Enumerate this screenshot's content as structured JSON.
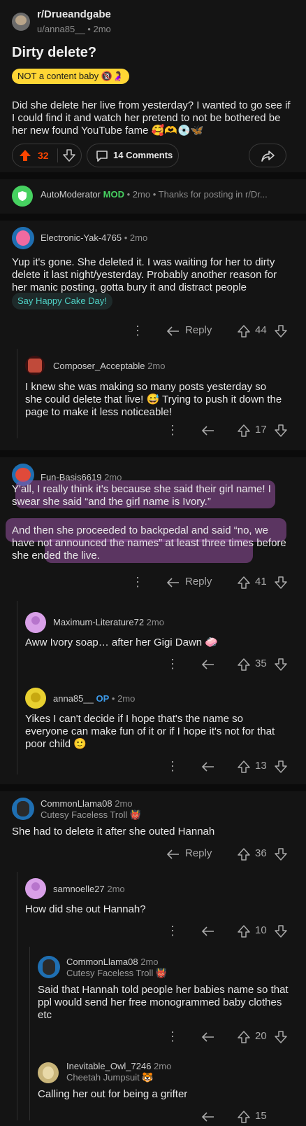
{
  "post": {
    "subreddit": "r/Drueandgabe",
    "author": "u/anna85__",
    "age": "2mo",
    "title": "Dirty delete?",
    "flair": "NOT a content baby",
    "body": "Did she delete her live from yesterday? I wanted to go see if I could find it and watch her pretend to not be bothered be her new found YouTube fame 🥰🫶💿🦋",
    "votes": "32",
    "comments_label": "14 Comments"
  },
  "automod": {
    "name": "AutoModerator",
    "mod_badge": "MOD",
    "age": "2mo",
    "preview": "Thanks for posting in r/Dr..."
  },
  "comments": [
    {
      "user": "Electronic-Yak-4765",
      "age": "2mo",
      "text": "Yup it's gone. She deleted it. I was waiting for her to dirty delete it last night/yesterday. Probably another reason for her manic posting, gotta bury it and distract people",
      "cake": "Say Happy Cake Day!",
      "votes": "44",
      "reply": "Reply"
    },
    {
      "user": "Composer_Acceptable",
      "age": "2mo",
      "text": "I knew she was making so many posts yesterday so she could delete that live! 😅 Trying to push it down the page to make it less noticeable!",
      "votes": "17"
    },
    {
      "user": "Fun-Basis6619",
      "age": "2mo",
      "text1": "Y'all, I really think it's because she said their girl name! I swear she said “and the girl name is Ivory.”",
      "text2": "And then she proceeded to backpedal and said “no, we have not announced the names” at least three times before she ended the live.",
      "votes": "41",
      "reply": "Reply"
    },
    {
      "user": "Maximum-Literature72",
      "age": "2mo",
      "text": "Aww Ivory soap… after her Gigi Dawn 🧼",
      "votes": "35"
    },
    {
      "user": "anna85__",
      "op": "OP",
      "age": "2mo",
      "text": "Yikes I can't decide if I hope that's the name so everyone can make fun of it or if I hope it's not for that poor child 🙂",
      "votes": "13"
    },
    {
      "user": "CommonLlama08",
      "age": "2mo",
      "flair": "Cutesy Faceless Troll",
      "text": "She had to delete it after she outed Hannah",
      "votes": "36",
      "reply": "Reply"
    },
    {
      "user": "samnoelle27",
      "age": "2mo",
      "text": "How did she out Hannah?",
      "votes": "10"
    },
    {
      "user": "CommonLlama08",
      "age": "2mo",
      "flair": "Cutesy Faceless Troll",
      "text": "Said that Hannah told people her babies name so that ppl would send her free monogrammed baby clothes etc",
      "votes": "20"
    },
    {
      "user": "Inevitable_Owl_7246",
      "age": "2mo",
      "flair": "Cheetah Jumpsuit",
      "text": "Calling her out for being a grifter",
      "votes": "15"
    }
  ],
  "colors": {
    "upvote_active": "#ff4500",
    "mod_green": "#46d160",
    "op_blue": "#3d9ae8",
    "flair_bg": "#ffd635",
    "highlight": "#8e4f9a",
    "cake_text": "#4fd1c5"
  }
}
